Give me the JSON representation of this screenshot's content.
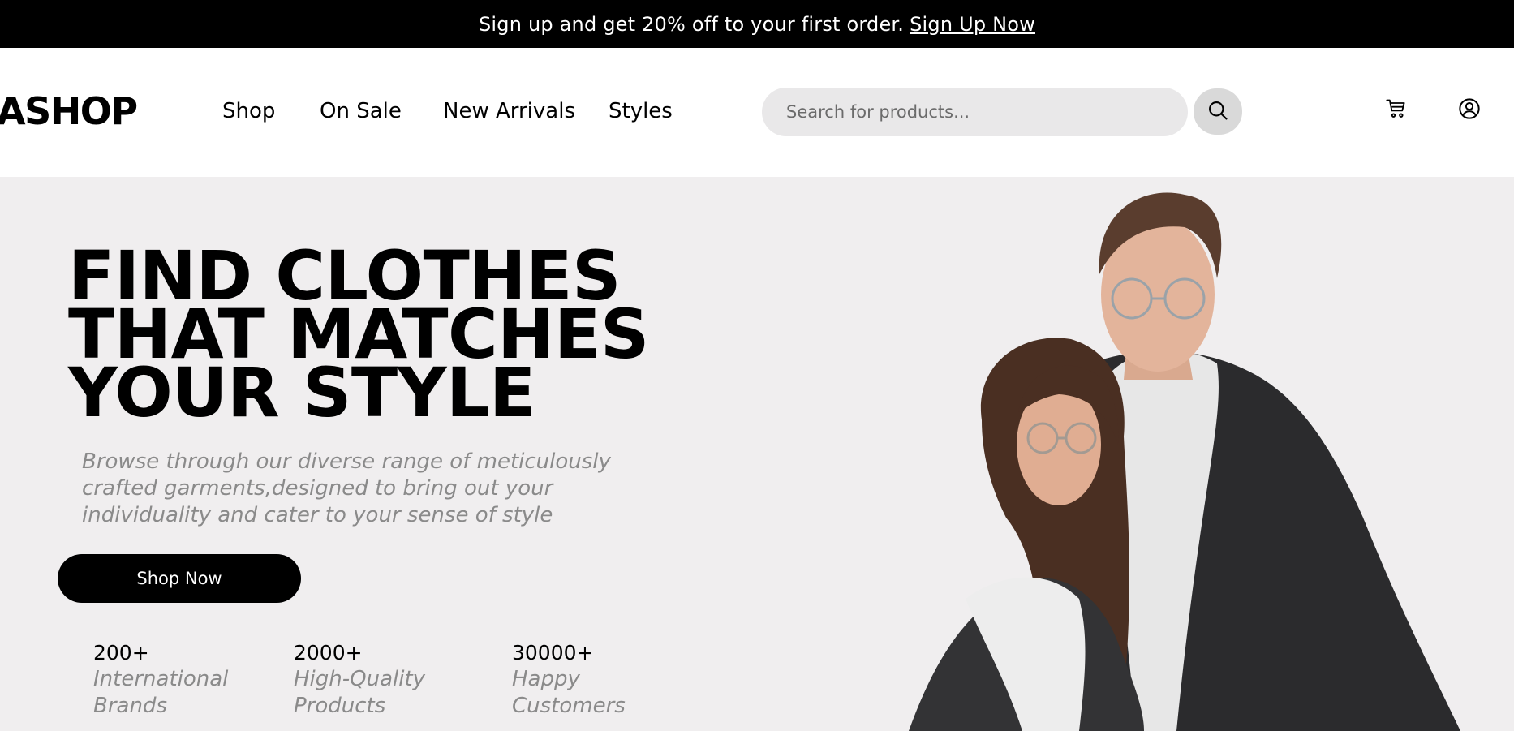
{
  "promo": {
    "text": "Sign up and get 20% off to your first order.",
    "link": "Sign Up Now"
  },
  "header": {
    "logo": "ASHOP",
    "nav": [
      "Shop",
      "On Sale",
      "New Arrivals",
      "Styles"
    ],
    "search": {
      "placeholder": "Search for products..."
    },
    "icons": [
      "search-icon",
      "cart-icon",
      "user-icon"
    ]
  },
  "hero": {
    "title_lines": [
      "FIND CLOTHES",
      "THAT MATCHES",
      "YOUR STYLE"
    ],
    "description": "Browse through our diverse range of meticulously crafted garments,designed to bring out your individuality and cater to your sense of style",
    "cta": "Shop Now",
    "stats": [
      {
        "value": "200+",
        "label": "International\nBrands"
      },
      {
        "value": "2000+",
        "label": "High-Quality\nProducts"
      },
      {
        "value": "30000+",
        "label": "Happy\nCustomers"
      }
    ]
  },
  "colors": {
    "promo_bg": "#000000",
    "hero_bg": "#f0eeef",
    "search_bg": "#e9e8e9",
    "muted_text": "#8a8a8a"
  }
}
